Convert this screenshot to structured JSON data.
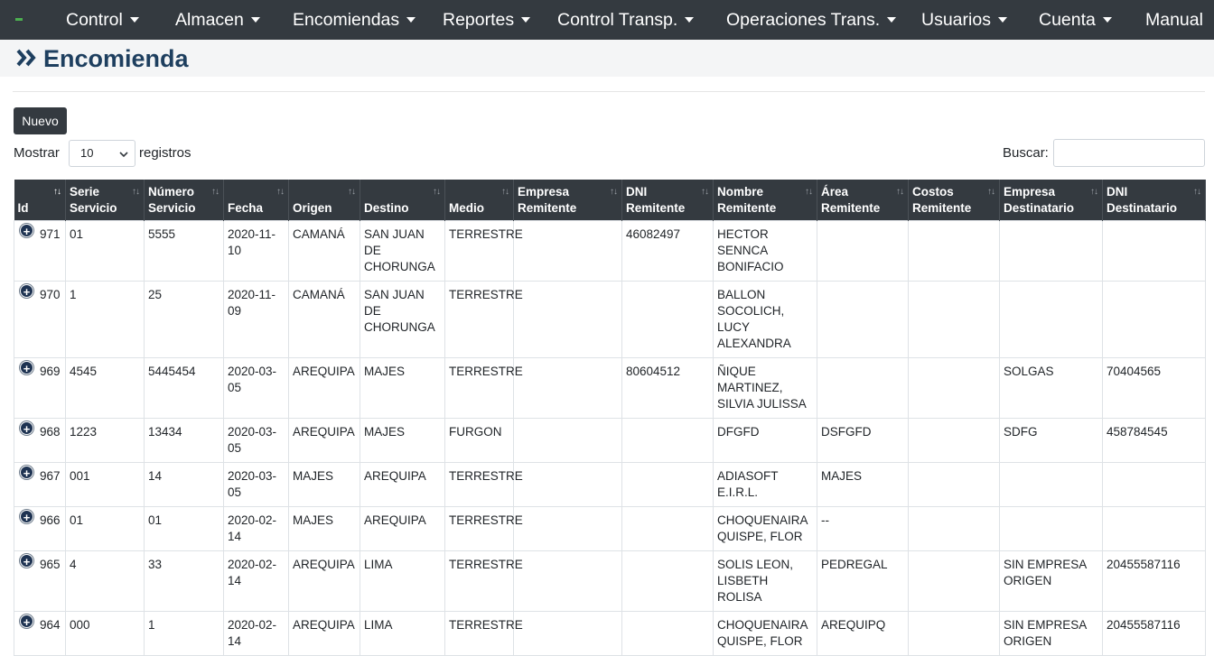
{
  "nav": {
    "items": [
      {
        "label": "Control",
        "caret": true
      },
      {
        "label": "Almacen",
        "caret": true
      },
      {
        "label": "Encomiendas",
        "caret": true
      },
      {
        "label": "Reportes",
        "caret": true
      },
      {
        "label": "Control Transp.",
        "caret": true
      },
      {
        "label": "Operaciones Trans.",
        "caret": true
      },
      {
        "label": "Usuarios",
        "caret": true
      },
      {
        "label": "Cuenta",
        "caret": true
      },
      {
        "label": "Manual",
        "caret": false
      }
    ]
  },
  "page": {
    "title": "Encomienda"
  },
  "controls": {
    "new_label": "Nuevo",
    "show_label": "Mostrar",
    "records_label": "registros",
    "page_length": "10",
    "search_label": "Buscar:",
    "search_value": ""
  },
  "table": {
    "columns": [
      "Id",
      "Serie Servicio",
      "Número Servicio",
      "Fecha",
      "Origen",
      "Destino",
      "Medio",
      "Empresa Remitente",
      "DNI Remitente",
      "Nombre Remitente",
      "Área Remitente",
      "Costos Remitente",
      "Empresa Destinatario",
      "DNI Destinatario"
    ],
    "rows": [
      [
        "971",
        "01",
        "5555",
        "2020-11-10",
        "CAMANÁ",
        "SAN JUAN DE CHORUNGA",
        "TERRESTRE",
        "",
        "46082497",
        "HECTOR SENNCA BONIFACIO",
        "",
        "",
        "",
        ""
      ],
      [
        "970",
        "1",
        "25",
        "2020-11-09",
        "CAMANÁ",
        "SAN JUAN DE CHORUNGA",
        "TERRESTRE",
        "",
        "",
        "BALLON SOCOLICH, LUCY ALEXANDRA",
        "",
        "",
        "",
        ""
      ],
      [
        "969",
        "4545",
        "5445454",
        "2020-03-05",
        "AREQUIPA",
        "MAJES",
        "TERRESTRE",
        "",
        "80604512",
        "ÑIQUE MARTINEZ, SILVIA JULISSA",
        "",
        "",
        "SOLGAS",
        "70404565"
      ],
      [
        "968",
        "1223",
        "13434",
        "2020-03-05",
        "AREQUIPA",
        "MAJES",
        "FURGON",
        "",
        "",
        "DFGFD",
        "DSFGFD",
        "",
        "SDFG",
        "458784545"
      ],
      [
        "967",
        "001",
        "14",
        "2020-03-05",
        "MAJES",
        "AREQUIPA",
        "TERRESTRE",
        "",
        "",
        "ADIASOFT E.I.R.L.",
        "MAJES",
        "",
        "",
        ""
      ],
      [
        "966",
        "01",
        "01",
        "2020-02-14",
        "MAJES",
        "AREQUIPA",
        "TERRESTRE",
        "",
        "",
        "CHOQUENAIRA QUISPE, FLOR",
        "--",
        "",
        "",
        ""
      ],
      [
        "965",
        "4",
        "33",
        "2020-02-14",
        "AREQUIPA",
        "LIMA",
        "TERRESTRE",
        "",
        "",
        "SOLIS LEON, LISBETH ROLISA",
        "PEDREGAL",
        "",
        "SIN EMPRESA ORIGEN",
        "20455587116"
      ],
      [
        "964",
        "000",
        "1",
        "2020-02-14",
        "AREQUIPA",
        "LIMA",
        "TERRESTRE",
        "",
        "",
        "CHOQUENAIRA QUISPE, FLOR",
        "AREQUIPQ",
        "",
        "SIN EMPRESA ORIGEN",
        "20455587116"
      ]
    ]
  }
}
